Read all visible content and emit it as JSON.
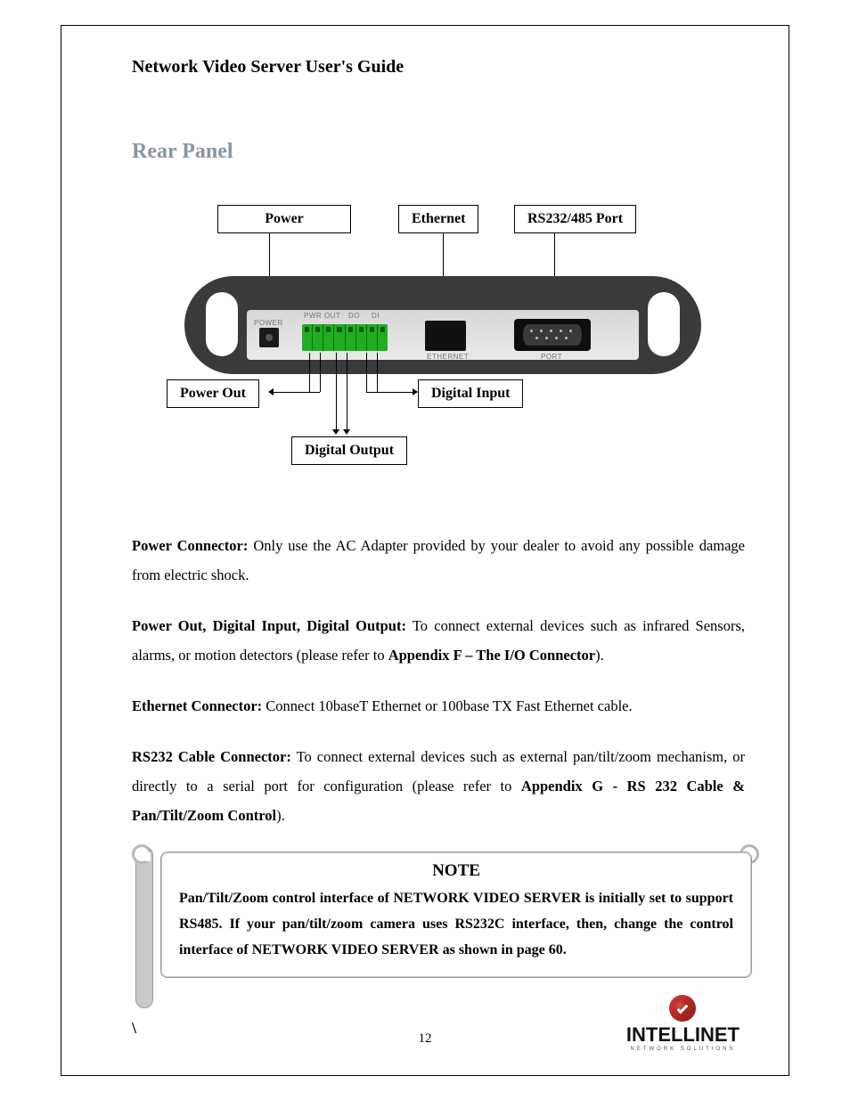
{
  "doc": {
    "title": "Network Video Server User's Guide",
    "section": "Rear Panel",
    "page_number": "12",
    "stray_char": "\\"
  },
  "diagram": {
    "callouts": {
      "power": "Power",
      "ethernet": "Ethernet",
      "rs_port": "RS232/485 Port",
      "power_out": "Power Out",
      "digital_output": "Digital Output",
      "digital_input": "Digital Input"
    },
    "device_labels": {
      "power": "POWER",
      "pwr_out": "PWR OUT",
      "do": "DO",
      "di": "DI",
      "ethernet": "ETHERNET",
      "port": "PORT"
    }
  },
  "paragraphs": {
    "p1_b": "Power Connector:",
    "p1_t": " Only use the AC Adapter provided by your dealer to avoid any possible damage from electric shock.",
    "p2_b": "Power Out, Digital Input, Digital Output:",
    "p2_t1": " To connect external devices such as infrared Sensors, alarms, or motion detectors (please refer to ",
    "p2_b2": "Appendix F – The I/O Connector",
    "p2_t2": ").",
    "p3_b": "Ethernet Connector:",
    "p3_t": " Connect 10baseT Ethernet or 100base TX Fast Ethernet cable.",
    "p4_b": "RS232 Cable Connector:",
    "p4_t1": " To connect external devices such as external pan/tilt/zoom mechanism, or directly to a serial port for configuration (please refer to ",
    "p4_b2": "Appendix G - RS 232 Cable & Pan/Tilt/Zoom Control",
    "p4_t2": ")."
  },
  "note": {
    "title": "NOTE",
    "body": "Pan/Tilt/Zoom control interface of NETWORK VIDEO SERVER is initially set to support RS485. If your pan/tilt/zoom camera uses RS232C interface, then, change the control interface of NETWORK VIDEO SERVER as shown in page 60."
  },
  "brand": {
    "name": "INTELLINET",
    "sub": "NETWORK SOLUTIONS"
  }
}
